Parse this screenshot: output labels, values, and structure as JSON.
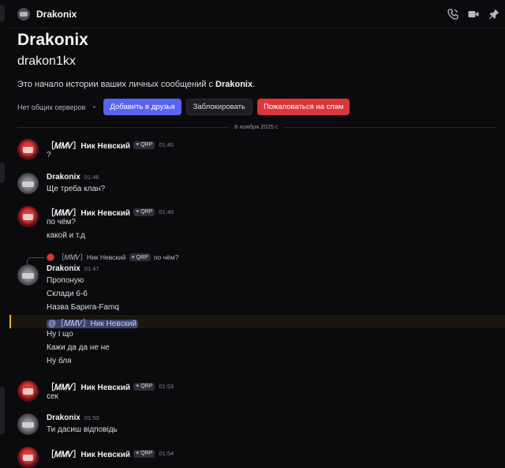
{
  "header": {
    "title": "Drakonix",
    "icons": [
      "phone-icon",
      "video-icon",
      "pin-icon"
    ]
  },
  "intro": {
    "display_name": "Drakonix",
    "username": "drakon1kx",
    "desc_prefix": "Это начало истории ваших личных сообщений с ",
    "desc_name": "Drakonix",
    "desc_suffix": ".",
    "no_mutual": "Нет общих серверов",
    "add_friend": "Добавить в друзья",
    "block": "Заблокировать",
    "report_spam": "Пожаловаться на спам"
  },
  "date_divider": "8 ноября 2025 г.",
  "users": {
    "nik": {
      "name": "［𝑀𝑀𝑉］Ник Невский",
      "tag": "QRP"
    },
    "drak": {
      "name": "Drakonix"
    }
  },
  "messages": {
    "m1": {
      "time": "01:46",
      "lines": [
        "?"
      ]
    },
    "m2": {
      "time": "01:46",
      "lines": [
        "Ще треба клан?"
      ]
    },
    "m3": {
      "time": "01:46",
      "lines": [
        "по чём?",
        "какой и т.д"
      ]
    },
    "m4": {
      "reply": {
        "name": "［𝑀𝑀𝑉］Ник Невский",
        "tag": "QRP",
        "text": "по чём?"
      },
      "time": "01:47",
      "lines": [
        "Пропоную",
        "Склади 6-6",
        "Назва Барига-Famq",
        "@［𝑀𝑀𝑉］Ник Невский",
        "Ну і що",
        "Кажи да да не не",
        "Ну бля"
      ]
    },
    "m5": {
      "time": "01:53",
      "lines": [
        "сек"
      ]
    },
    "m6": {
      "time": "01:53",
      "lines": [
        "Ти дасиш відповідь"
      ]
    },
    "m7": {
      "time": "01:54"
    }
  },
  "colors": {
    "background": "#0b0b0d",
    "primary_button": "#5865f2",
    "danger_button": "#da373c",
    "mention_highlight": "#f0b232",
    "badge_heart": "#c084fc"
  }
}
